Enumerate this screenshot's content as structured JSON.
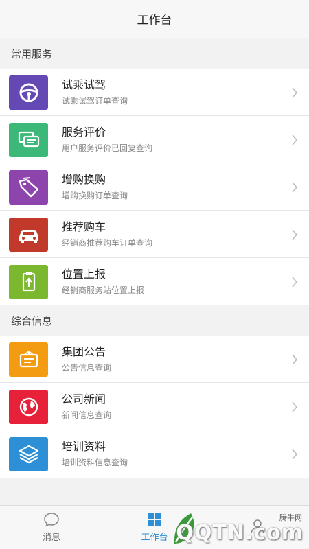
{
  "header": {
    "title": "工作台"
  },
  "sections": [
    {
      "title": "常用服务",
      "items": [
        {
          "title": "试乘试驾",
          "subtitle": "试乘试驾订单查询",
          "icon": "steering-wheel-icon",
          "color": "#6449b5"
        },
        {
          "title": "服务评价",
          "subtitle": "用户服务评价已回复查询",
          "icon": "chat-bubbles-icon",
          "color": "#3cb878"
        },
        {
          "title": "增购换购",
          "subtitle": "增购换购订单查询",
          "icon": "price-tag-icon",
          "color": "#8e44ad"
        },
        {
          "title": "推荐购车",
          "subtitle": "经销商推荐购车订单查询",
          "icon": "car-icon",
          "color": "#c0392b"
        },
        {
          "title": "位置上报",
          "subtitle": "经销商服务站位置上报",
          "icon": "location-upload-icon",
          "color": "#7cb82f"
        }
      ]
    },
    {
      "title": "综合信息",
      "items": [
        {
          "title": "集团公告",
          "subtitle": "公告信息查询",
          "icon": "notice-board-icon",
          "color": "#f39c12"
        },
        {
          "title": "公司新闻",
          "subtitle": "新闻信息查询",
          "icon": "globe-icon",
          "color": "#e8213a"
        },
        {
          "title": "培训资料",
          "subtitle": "培训资料信息查询",
          "icon": "layers-icon",
          "color": "#2d8fd5"
        }
      ]
    }
  ],
  "tabbar": {
    "tabs": [
      {
        "label": "消息",
        "icon": "message-icon",
        "active": false
      },
      {
        "label": "工作台",
        "icon": "grid-icon",
        "active": true
      },
      {
        "label": "",
        "icon": "person-icon",
        "active": false
      }
    ]
  },
  "watermark": {
    "text": "QQTN.com",
    "small": "腾牛网"
  },
  "colors": {
    "accent": "#2d8fd5",
    "background": "#f2f2f2"
  }
}
